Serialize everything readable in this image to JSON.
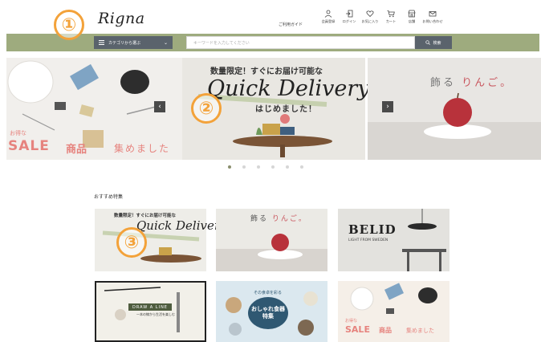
{
  "header": {
    "logo": "Rigna",
    "guide": "ご利用ガイド",
    "icons": [
      {
        "label": "会員登録",
        "icon": "person-icon"
      },
      {
        "label": "ログイン",
        "icon": "login-icon"
      },
      {
        "label": "お気に入り",
        "icon": "heart-icon"
      },
      {
        "label": "カート",
        "icon": "cart-icon"
      },
      {
        "label": "店舗",
        "icon": "store-icon"
      },
      {
        "label": "お問い合わせ",
        "icon": "mail-icon"
      }
    ]
  },
  "nav": {
    "category_button": "カテゴリから選ぶ",
    "search_placeholder": "キーワードを入力してください",
    "search_button": "検索",
    "bar_color": "#9eab7e"
  },
  "callouts": [
    "①",
    "②",
    "③"
  ],
  "hero": {
    "slide1": {
      "small": "お得な",
      "sale": "SALE",
      "item": "商品",
      "text": "集めました"
    },
    "slide2": {
      "top": "数量限定！すぐにお届け可能な",
      "main": "Quick Delivery",
      "sub": "はじめました！"
    },
    "slide3": {
      "text1": "飾る",
      "text2": "りんご。"
    },
    "prev": "‹",
    "next": "›",
    "dot_count": 6,
    "active_dot": 0
  },
  "recommended": {
    "title": "おすすめ特集",
    "card1": {
      "top": "数量限定！すぐにお届け可能な",
      "main": "Quick Delivery"
    },
    "card2": {
      "text1": "飾る",
      "text2": "りんご。"
    },
    "card3": {
      "brand": "BELID",
      "sub": "LIGHT FROM SWEDEN"
    },
    "card4": {
      "title": "DRAW A LINE",
      "sub": "一本の線から生活を楽しむ"
    },
    "card5": {
      "top": "その食卓を彩る",
      "main1": "おしゃれ食器",
      "main2": "特集"
    },
    "card6": {
      "small": "お得な",
      "sale": "SALE",
      "item": "商品",
      "text": "集めました"
    }
  }
}
